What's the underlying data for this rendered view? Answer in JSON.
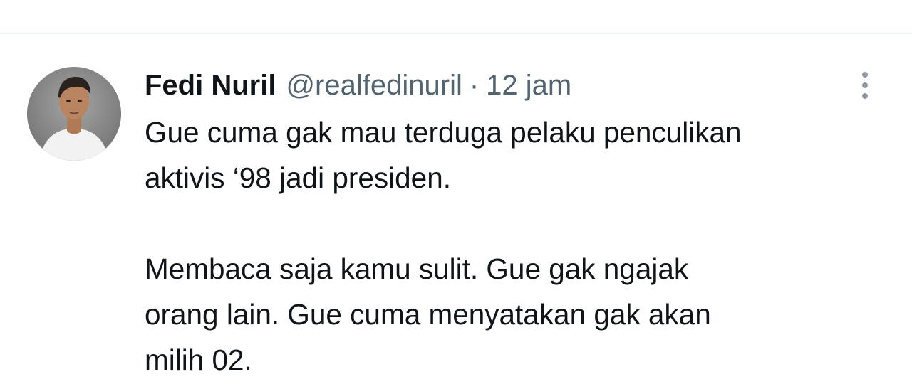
{
  "tweet": {
    "author_name": "Fedi Nuril",
    "author_handle": "@realfedinuril",
    "separator": "·",
    "timestamp": "12 jam",
    "avatar_icon": "profile-photo",
    "more_icon": "more-vertical-icon",
    "paragraphs": [
      {
        "lines": [
          "Gue cuma gak mau terduga pelaku penculikan",
          "aktivis ‘98 jadi presiden."
        ]
      },
      {
        "lines": [
          "Membaca saja kamu sulit. Gue gak ngajak",
          "orang lain. Gue cuma menyatakan gak akan",
          "milih 02."
        ]
      }
    ]
  },
  "colors": {
    "text_primary": "#0f1419",
    "text_secondary": "#536471",
    "divider": "#eff3f4",
    "icon_muted": "#8b98a5"
  }
}
